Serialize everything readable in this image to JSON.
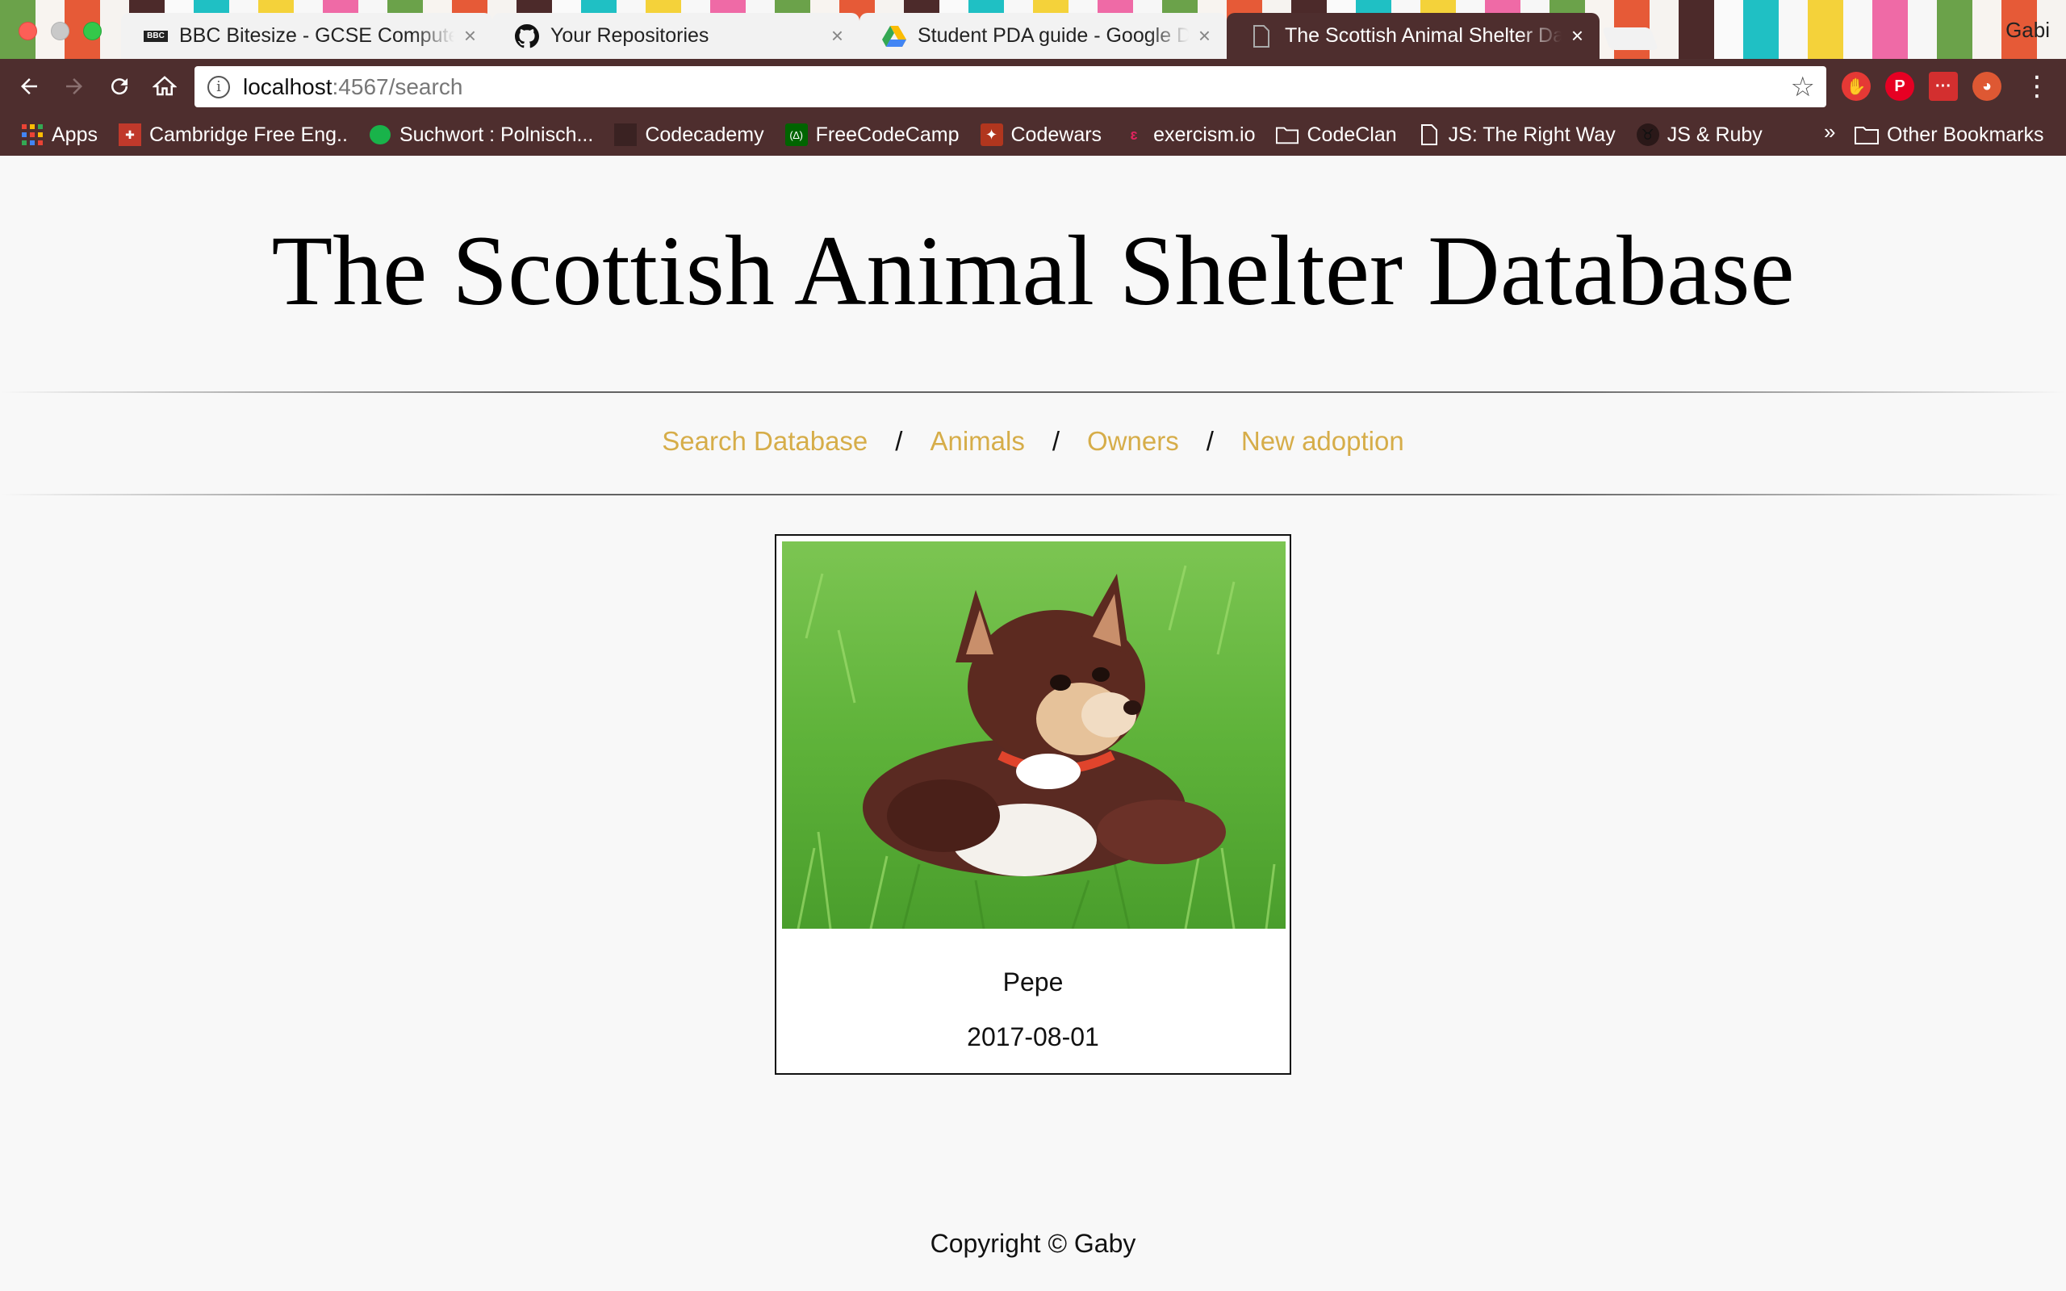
{
  "browser": {
    "tabs": [
      {
        "title": "BBC Bitesize - GCSE Computer",
        "icon": "bbc-icon"
      },
      {
        "title": "Your Repositories",
        "icon": "github-icon"
      },
      {
        "title": "Student PDA guide - Google Drive",
        "icon": "google-drive-icon"
      },
      {
        "title": "The Scottish Animal Shelter Database",
        "icon": "document-icon"
      }
    ],
    "close_glyph": "×",
    "profile_name": "Gabi",
    "url_host": "localhost",
    "url_rest": ":4567/search",
    "bookmarks": [
      {
        "label": "Apps",
        "icon": "apps-grid-icon"
      },
      {
        "label": "Cambridge Free Eng..",
        "icon": "cambridge-icon"
      },
      {
        "label": "Suchwort : Polnisch...",
        "icon": "speech-bubble-icon"
      },
      {
        "label": "Codecademy",
        "icon": "codecademy-icon"
      },
      {
        "label": "FreeCodeCamp",
        "icon": "freecodecamp-icon"
      },
      {
        "label": "Codewars",
        "icon": "codewars-icon"
      },
      {
        "label": "exercism.io",
        "icon": "exercism-icon"
      },
      {
        "label": "CodeClan",
        "icon": "folder-icon"
      },
      {
        "label": "JS: The Right Way",
        "icon": "document-icon"
      },
      {
        "label": "JS & Ruby",
        "icon": "bull-icon"
      }
    ],
    "bookmarks_more": "»",
    "other_bookmarks": "Other Bookmarks"
  },
  "page": {
    "title": "The Scottish Animal Shelter Database",
    "nav": [
      {
        "label": "Search Database"
      },
      {
        "label": "Animals"
      },
      {
        "label": "Owners"
      },
      {
        "label": "New adoption"
      }
    ],
    "nav_separator": "/",
    "result": {
      "name": "Pepe",
      "date": "2017-08-01"
    },
    "footer": "Copyright © Gaby"
  },
  "colors": {
    "chrome": "#4e2e2e",
    "link": "#d6ad49",
    "page_bg": "#f8f8f8"
  }
}
